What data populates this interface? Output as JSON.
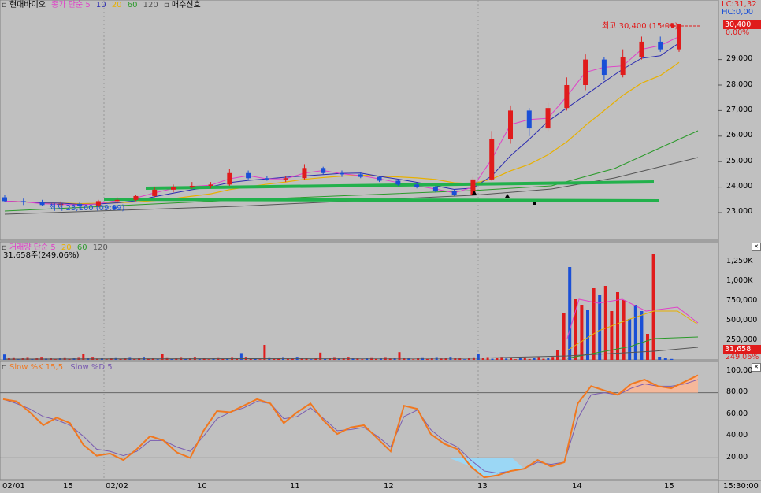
{
  "stock": {
    "name": "현대바이오",
    "price_legend": {
      "prefix": "종가 단순",
      "ma": [
        "5",
        "10",
        "20",
        "60",
        "120"
      ]
    },
    "signal_label": "매수신호",
    "lc": "LC:31,32",
    "hc": "HC:0,00",
    "current_price": "30,400",
    "current_change": "0.00%",
    "high_label": "최고 30,400 (15:09)",
    "low_label": "최저 23,160 (09:09)"
  },
  "volume": {
    "legend_prefix": "거래량 단순",
    "ma": [
      "5",
      "20",
      "60",
      "120"
    ],
    "last_value": "31,658주(249,06%)",
    "tag_value": "31,658",
    "tag_pct": "249,06%",
    "axis": [
      "1,250K",
      "1,000K",
      "750,000",
      "500,000",
      "250,000"
    ]
  },
  "stoch": {
    "k_label": "Slow %K 15,5",
    "d_label": "Slow %D 5",
    "axis": [
      "100,00",
      "80,00",
      "60,00",
      "40,00",
      "20,00"
    ]
  },
  "price_axis": [
    "29,000",
    "28,000",
    "27,000",
    "26,000",
    "25,000",
    "24,000",
    "23,000"
  ],
  "time_axis": [
    "02/01",
    "15",
    "02/02",
    "10",
    "11",
    "12",
    "13",
    "14",
    "15",
    "15:30:00"
  ],
  "colors": {
    "up": "#e01b1b",
    "down": "#1a4fd6",
    "ma5": "#e040c8",
    "ma10": "#2b2bb0",
    "ma20": "#e8b000",
    "ma60": "#2a9a2a",
    "ma120": "#555555",
    "trendline": "#22b14c",
    "stoch_k": "#f07820",
    "stoch_d": "#7a5bb0"
  },
  "chart_data": [
    {
      "type": "candlestick",
      "title": "현대바이오",
      "ylim": [
        22500,
        31300
      ],
      "y_ticks": [
        23000,
        24000,
        25000,
        26000,
        27000,
        28000,
        29000
      ],
      "candles_approx": [
        {
          "o": 23600,
          "h": 23700,
          "l": 23400,
          "c": 23450
        },
        {
          "o": 23450,
          "h": 23550,
          "l": 23300,
          "c": 23400
        },
        {
          "o": 23400,
          "h": 23500,
          "l": 23250,
          "c": 23300
        },
        {
          "o": 23300,
          "h": 23450,
          "l": 23200,
          "c": 23350
        },
        {
          "o": 23350,
          "h": 23400,
          "l": 23160,
          "c": 23250
        },
        {
          "o": 23250,
          "h": 23500,
          "l": 23200,
          "c": 23450
        },
        {
          "o": 23450,
          "h": 23600,
          "l": 23350,
          "c": 23500
        },
        {
          "o": 23500,
          "h": 23700,
          "l": 23450,
          "c": 23650
        },
        {
          "o": 23650,
          "h": 24000,
          "l": 23600,
          "c": 23900
        },
        {
          "o": 23900,
          "h": 24100,
          "l": 23800,
          "c": 24000
        },
        {
          "o": 24000,
          "h": 24200,
          "l": 23950,
          "c": 24050
        },
        {
          "o": 24050,
          "h": 24200,
          "l": 23950,
          "c": 24100
        },
        {
          "o": 24100,
          "h": 24700,
          "l": 24050,
          "c": 24550
        },
        {
          "o": 24550,
          "h": 24650,
          "l": 24300,
          "c": 24350
        },
        {
          "o": 24350,
          "h": 24450,
          "l": 24250,
          "c": 24300
        },
        {
          "o": 24300,
          "h": 24450,
          "l": 24200,
          "c": 24350
        },
        {
          "o": 24350,
          "h": 24900,
          "l": 24300,
          "c": 24750
        },
        {
          "o": 24750,
          "h": 24800,
          "l": 24500,
          "c": 24550
        },
        {
          "o": 24550,
          "h": 24650,
          "l": 24400,
          "c": 24500
        },
        {
          "o": 24500,
          "h": 24600,
          "l": 24350,
          "c": 24400
        },
        {
          "o": 24400,
          "h": 24450,
          "l": 24200,
          "c": 24250
        },
        {
          "o": 24250,
          "h": 24300,
          "l": 24050,
          "c": 24100
        },
        {
          "o": 24100,
          "h": 24150,
          "l": 23950,
          "c": 24000
        },
        {
          "o": 24000,
          "h": 24050,
          "l": 23800,
          "c": 23850
        },
        {
          "o": 23850,
          "h": 23900,
          "l": 23650,
          "c": 23700
        },
        {
          "o": 23700,
          "h": 24400,
          "l": 23650,
          "c": 24300
        },
        {
          "o": 24300,
          "h": 26200,
          "l": 24250,
          "c": 25900
        },
        {
          "o": 25900,
          "h": 27200,
          "l": 25700,
          "c": 27000
        },
        {
          "o": 27000,
          "h": 27100,
          "l": 26000,
          "c": 26300
        },
        {
          "o": 26300,
          "h": 27300,
          "l": 26200,
          "c": 27100
        },
        {
          "o": 27100,
          "h": 28300,
          "l": 27000,
          "c": 28000
        },
        {
          "o": 28000,
          "h": 29200,
          "l": 27800,
          "c": 29000
        },
        {
          "o": 29000,
          "h": 29100,
          "l": 28200,
          "c": 28400
        },
        {
          "o": 28400,
          "h": 29400,
          "l": 28300,
          "c": 29100
        },
        {
          "o": 29100,
          "h": 29900,
          "l": 29000,
          "c": 29700
        },
        {
          "o": 29700,
          "h": 29900,
          "l": 29300,
          "c": 29400
        },
        {
          "o": 29400,
          "h": 30400,
          "l": 29300,
          "c": 30400
        }
      ]
    },
    {
      "type": "bar",
      "title": "거래량",
      "ylim": [
        0,
        1400000
      ],
      "y_ticks": [
        250000,
        500000,
        750000,
        1000000,
        1250000
      ],
      "last_value": 31658
    },
    {
      "type": "line",
      "title": "Slow %K 15,5 / Slow %D 5",
      "ylim": [
        0,
        105
      ],
      "y_ticks": [
        20,
        40,
        60,
        80,
        100
      ],
      "series": [
        {
          "name": "Slow %K 15,5",
          "values": [
            74,
            72,
            62,
            50,
            57,
            52,
            32,
            22,
            24,
            18,
            28,
            40,
            36,
            25,
            20,
            45,
            63,
            62,
            68,
            74,
            70,
            52,
            62,
            70,
            54,
            42,
            48,
            50,
            38,
            26,
            68,
            65,
            42,
            33,
            28,
            12,
            2,
            4,
            8,
            10,
            18,
            12,
            16,
            70,
            86,
            82,
            78,
            88,
            92,
            86,
            84,
            90,
            96
          ]
        },
        {
          "name": "Slow %D 5",
          "values": [
            74,
            70,
            65,
            58,
            55,
            50,
            40,
            28,
            26,
            22,
            26,
            36,
            36,
            30,
            26,
            40,
            56,
            62,
            66,
            72,
            70,
            56,
            58,
            66,
            56,
            45,
            46,
            48,
            40,
            30,
            58,
            64,
            46,
            36,
            30,
            18,
            8,
            6,
            8,
            10,
            16,
            14,
            16,
            56,
            78,
            80,
            78,
            84,
            88,
            86,
            86,
            88,
            92
          ]
        }
      ]
    }
  ]
}
